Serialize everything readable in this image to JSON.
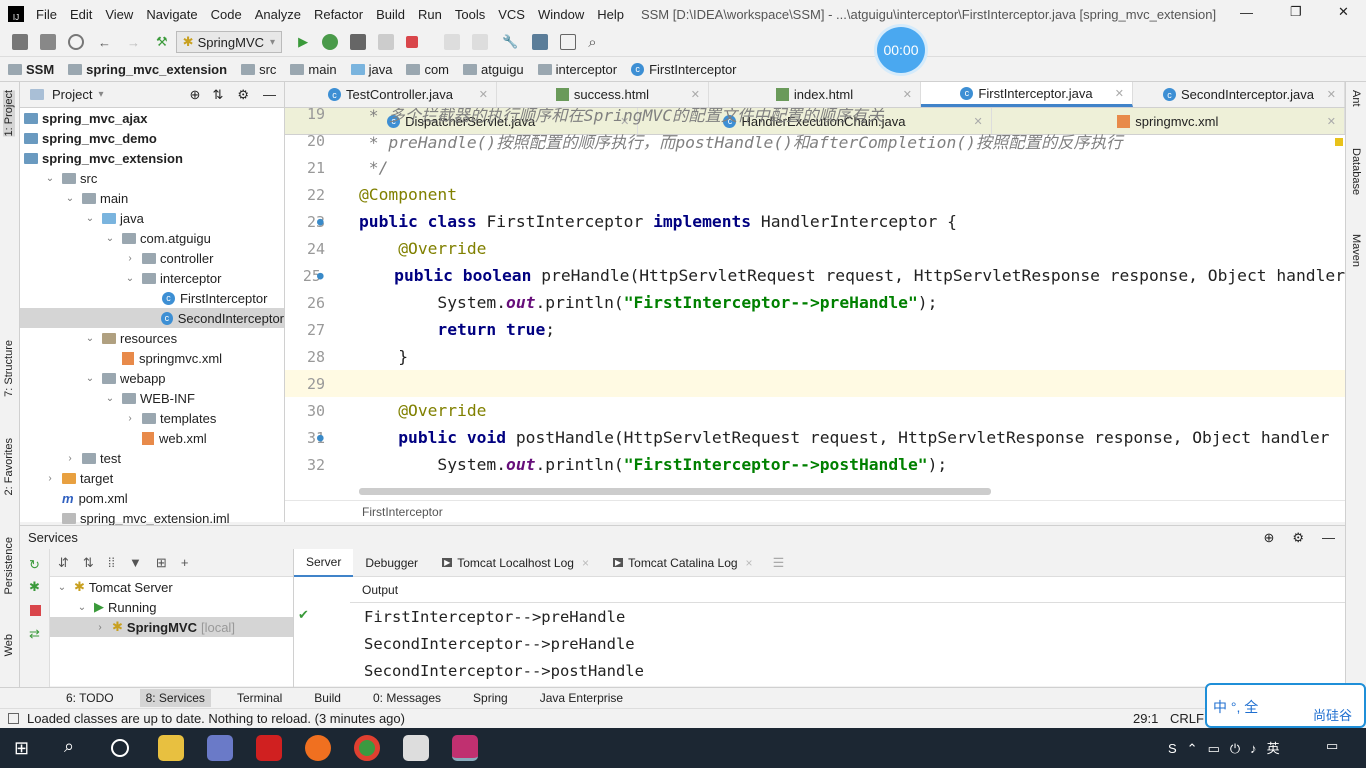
{
  "titlebar": {
    "app_icon": "intellij-icon",
    "menu": [
      "File",
      "Edit",
      "View",
      "Navigate",
      "Code",
      "Analyze",
      "Refactor",
      "Build",
      "Run",
      "Tools",
      "VCS",
      "Window",
      "Help"
    ],
    "title": "SSM [D:\\IDEA\\workspace\\SSM] - ...\\atguigu\\interceptor\\FirstInterceptor.java [spring_mvc_extension]"
  },
  "toolbar": {
    "run_config": "SpringMVC",
    "timer": "00:00"
  },
  "breadcrumb": [
    "SSM",
    "spring_mvc_extension",
    "src",
    "main",
    "java",
    "com",
    "atguigu",
    "interceptor",
    "FirstInterceptor"
  ],
  "left_stripe": [
    "1: Project",
    "7: Structure",
    "2: Favorites",
    "Persistence",
    "Web"
  ],
  "right_stripe": [
    "Ant",
    "Database",
    "Maven"
  ],
  "project": {
    "title": "Project",
    "items": [
      {
        "label": "spring_mvc_ajax",
        "depth": 0,
        "bold": true
      },
      {
        "label": "spring_mvc_demo",
        "depth": 0,
        "bold": true
      },
      {
        "label": "spring_mvc_extension",
        "depth": 0,
        "bold": true
      },
      {
        "label": "src",
        "depth": 1,
        "open": true
      },
      {
        "label": "main",
        "depth": 2,
        "open": true
      },
      {
        "label": "java",
        "depth": 3,
        "open": true
      },
      {
        "label": "com.atguigu",
        "depth": 4,
        "open": true
      },
      {
        "label": "controller",
        "depth": 5,
        "open": false
      },
      {
        "label": "interceptor",
        "depth": 5,
        "open": true
      },
      {
        "label": "FirstInterceptor",
        "depth": 6,
        "type": "class"
      },
      {
        "label": "SecondInterceptor",
        "depth": 6,
        "type": "class",
        "selected": true
      },
      {
        "label": "resources",
        "depth": 3,
        "open": true
      },
      {
        "label": "springmvc.xml",
        "depth": 4,
        "type": "xml"
      },
      {
        "label": "webapp",
        "depth": 3,
        "open": true
      },
      {
        "label": "WEB-INF",
        "depth": 4,
        "open": true
      },
      {
        "label": "templates",
        "depth": 5,
        "open": false
      },
      {
        "label": "web.xml",
        "depth": 5,
        "type": "xml"
      },
      {
        "label": "test",
        "depth": 2,
        "open": false
      },
      {
        "label": "target",
        "depth": 1,
        "open": false
      },
      {
        "label": "pom.xml",
        "depth": 1,
        "type": "maven"
      },
      {
        "label": "spring_mvc_extension.iml",
        "depth": 1,
        "type": "file"
      }
    ]
  },
  "editor": {
    "tabs_row1": [
      {
        "label": "TestController.java",
        "icon": "class"
      },
      {
        "label": "success.html",
        "icon": "html"
      },
      {
        "label": "index.html",
        "icon": "html"
      },
      {
        "label": "FirstInterceptor.java",
        "icon": "class",
        "active": true
      },
      {
        "label": "SecondInterceptor.java",
        "icon": "class"
      }
    ],
    "tabs_row2": [
      {
        "label": "DispatcherServlet.java",
        "icon": "class"
      },
      {
        "label": "HandlerExecutionChain.java",
        "icon": "class"
      },
      {
        "label": "springmvc.xml",
        "icon": "xml"
      }
    ],
    "lines": [
      {
        "n": "19",
        "t": [
          [
            " * 多个拦截器的执行顺序和在SpringMVC的配置文件中配置的顺序有关",
            "cm"
          ]
        ]
      },
      {
        "n": "20",
        "t": [
          [
            " * preHandle()按照配置的顺序执行，而postHandle()和afterCompletion()按照配置的反序执行",
            "cm"
          ]
        ]
      },
      {
        "n": "21",
        "t": [
          [
            " */",
            "cm"
          ]
        ]
      },
      {
        "n": "22",
        "t": [
          [
            "@Component",
            "an"
          ]
        ]
      },
      {
        "n": "23",
        "t": [
          [
            "public class ",
            "kw"
          ],
          [
            "FirstInterceptor ",
            ""
          ],
          [
            "implements ",
            "kw"
          ],
          [
            "HandlerInterceptor {",
            ""
          ]
        ]
      },
      {
        "n": "24",
        "t": [
          [
            "    ",
            ""
          ],
          [
            "@Override",
            "an"
          ]
        ]
      },
      {
        "n": "25",
        "t": [
          [
            "    ",
            ""
          ],
          [
            "public boolean ",
            "kw"
          ],
          [
            "preHandle(HttpServletRequest request, HttpServletResponse response, Object handler",
            ""
          ]
        ]
      },
      {
        "n": "26",
        "t": [
          [
            "        System.",
            ""
          ],
          [
            "out",
            "fl"
          ],
          [
            ".println(",
            ""
          ],
          [
            "\"FirstInterceptor-->preHandle\"",
            "st"
          ],
          [
            ");",
            ""
          ]
        ]
      },
      {
        "n": "27",
        "t": [
          [
            "        ",
            ""
          ],
          [
            "return true",
            "kw"
          ],
          [
            ";",
            ""
          ]
        ]
      },
      {
        "n": "28",
        "t": [
          [
            "    }",
            ""
          ]
        ]
      },
      {
        "n": "29",
        "t": [
          [
            "",
            ""
          ]
        ],
        "current": true
      },
      {
        "n": "30",
        "t": [
          [
            "    ",
            ""
          ],
          [
            "@Override",
            "an"
          ]
        ]
      },
      {
        "n": "31",
        "t": [
          [
            "    ",
            ""
          ],
          [
            "public void ",
            "kw"
          ],
          [
            "postHandle(HttpServletRequest request, HttpServletResponse response, Object handler",
            ""
          ]
        ]
      },
      {
        "n": "32",
        "t": [
          [
            "        System.",
            ""
          ],
          [
            "out",
            "fl"
          ],
          [
            ".println(",
            ""
          ],
          [
            "\"FirstInterceptor-->postHandle\"",
            "st"
          ],
          [
            ");",
            ""
          ]
        ]
      }
    ],
    "footer_crumb": "FirstInterceptor"
  },
  "services": {
    "title": "Services",
    "tree": [
      {
        "label": "Tomcat Server"
      },
      {
        "label": "Running"
      },
      {
        "label": "SpringMVC",
        "suffix": "[local]"
      }
    ],
    "tabs": [
      "Server",
      "Debugger",
      "Tomcat Localhost Log",
      "Tomcat Catalina Log"
    ],
    "output_label": "Output",
    "output": [
      "FirstInterceptor-->preHandle",
      "SecondInterceptor-->preHandle",
      "SecondInterceptor-->postHandle"
    ]
  },
  "bottom_tabs": [
    "6: TODO",
    "8: Services",
    "Terminal",
    "Build",
    "0: Messages",
    "Spring",
    "Java Enterprise"
  ],
  "status": {
    "message": "Loaded classes are up to date. Nothing to reload. (3 minutes ago)",
    "position": "29:1",
    "line_sep": "CRLF"
  },
  "ime": {
    "text": "中 °, 全",
    "brand": "尚硅谷"
  },
  "colors": {
    "accent": "#4083c9",
    "keyword": "#000080",
    "string": "#008000",
    "annotation": "#808000",
    "comment": "#808080"
  }
}
